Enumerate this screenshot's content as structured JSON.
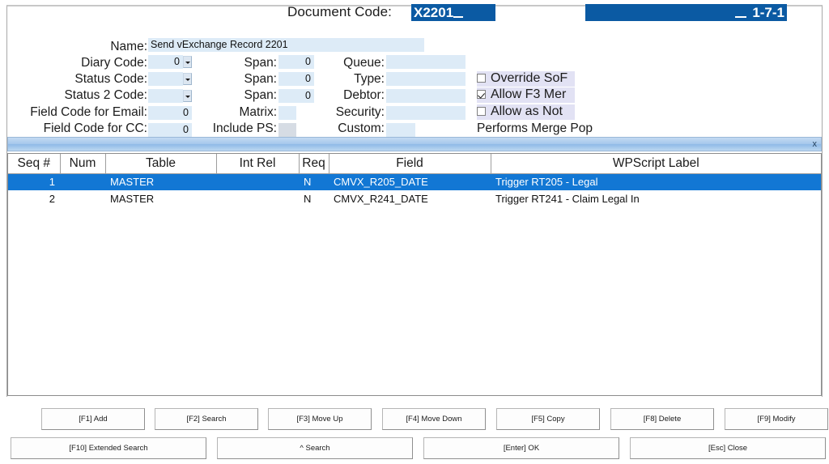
{
  "header": {
    "document_code_label": "Document Code:",
    "document_code_value": "X2201",
    "revision": "1-7-1"
  },
  "form": {
    "fields": [
      {
        "label": "Name:",
        "value": "Send vExchange Record 2201"
      },
      {
        "label": "Diary Code:",
        "value": "0"
      },
      {
        "label": "Status Code:",
        "value": ""
      },
      {
        "label": "Status 2 Code:",
        "value": ""
      },
      {
        "label": "Field Code for Email:",
        "value": "0"
      },
      {
        "label": "Field Code for CC:",
        "value": "0"
      }
    ],
    "mid": [
      {
        "label": "Span:",
        "value": "0"
      },
      {
        "label": "Span:",
        "value": "0"
      },
      {
        "label": "Span:",
        "value": "0"
      },
      {
        "label": "Matrix:",
        "value": ""
      },
      {
        "label": "Include PS:",
        "value": ""
      }
    ],
    "right": [
      {
        "label": "Queue:",
        "value": ""
      },
      {
        "label": "Type:",
        "value": ""
      },
      {
        "label": "Debtor:",
        "value": ""
      },
      {
        "label": "Security:",
        "value": ""
      },
      {
        "label": "Custom:",
        "value": ""
      }
    ],
    "checkboxes": [
      {
        "label": "Override SoF",
        "checked": false
      },
      {
        "label": "Allow F3 Mer",
        "checked": true
      },
      {
        "label": "Allow as Not",
        "checked": false
      }
    ],
    "merge_note": "Performs Merge Pop"
  },
  "grid": {
    "close_label": "x",
    "columns": [
      "Seq #",
      "Num",
      "Table",
      "Int Rel",
      "Req",
      "Field",
      "WPScript Label"
    ],
    "rows": [
      {
        "seq": "1",
        "num": "",
        "table": "MASTER",
        "int_rel": "",
        "req": "N",
        "field": "CMVX_R205_DATE",
        "wpscript_label": "Trigger RT205 - Legal",
        "selected": true
      },
      {
        "seq": "2",
        "num": "",
        "table": "MASTER",
        "int_rel": "",
        "req": "N",
        "field": "CMVX_R241_DATE",
        "wpscript_label": "Trigger RT241 - Claim Legal In",
        "selected": false
      }
    ]
  },
  "buttons": {
    "row1": [
      "[F1] Add",
      "[F2] Search",
      "[F3] Move Up",
      "[F4] Move Down",
      "[F5] Copy",
      "[F8] Delete",
      "[F9] Modify"
    ],
    "row2": [
      "[F10] Extended Search",
      "^ Search",
      "[Enter] OK",
      "[Esc] Close"
    ]
  },
  "colors": {
    "accent_blue": "#0b5aa3",
    "selection_blue": "#1277d4",
    "field_bg": "#ddebf7",
    "checkbox_panel_bg": "#e2e2f4"
  }
}
